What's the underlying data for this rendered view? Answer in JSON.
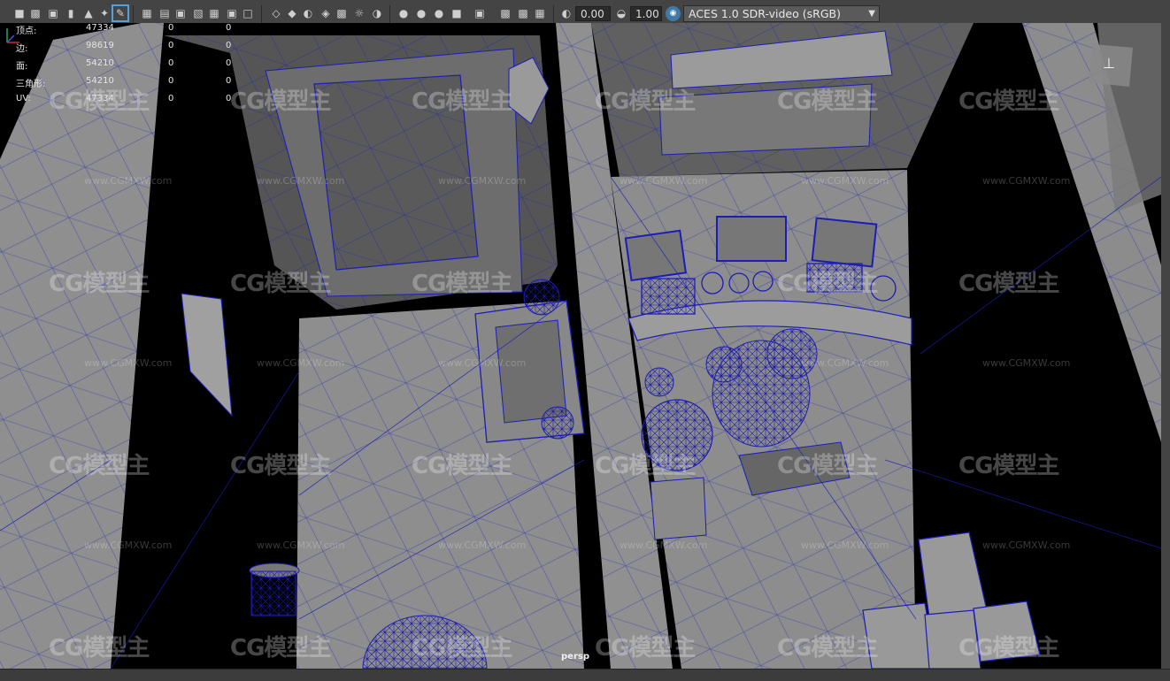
{
  "toolbar": {
    "icons": [
      "camera-icon",
      "camera-attributes-icon",
      "camera-lock-icon",
      "bookmark-icon",
      "image-plane-icon",
      "2d-pan-icon",
      "grease-pencil-icon",
      "grid-icon",
      "film-gate-icon",
      "resolution-gate-icon",
      "gate-mask-icon",
      "field-chart-icon",
      "safe-action-icon",
      "safe-title-icon",
      "wireframe-icon",
      "smooth-shade-icon",
      "default-material-icon",
      "wireframe-on-shaded-icon",
      "textured-icon",
      "use-all-lights-icon",
      "shadows-icon",
      "screen-space-ao-icon",
      "motion-blur-icon",
      "anti-aliasing-icon",
      "isolate-select-icon",
      "xray-icon",
      "xray-joints-icon",
      "xray-components-icon",
      "exposure-icon",
      "gamma-icon"
    ],
    "exposure_value": "0.00",
    "gamma_value": "1.00",
    "color_space": "ACES 1.0 SDR-video (sRGB)"
  },
  "hud": {
    "rows": [
      {
        "label": "顶点:",
        "v1": "47334",
        "v2": "0",
        "v3": "0"
      },
      {
        "label": "边:",
        "v1": "98619",
        "v2": "0",
        "v3": "0"
      },
      {
        "label": "面:",
        "v1": "54210",
        "v2": "0",
        "v3": "0"
      },
      {
        "label": "三角形:",
        "v1": "54210",
        "v2": "0",
        "v3": "0"
      },
      {
        "label": "UV:",
        "v1": "47334",
        "v2": "0",
        "v3": "0"
      }
    ]
  },
  "viewport": {
    "camera_label": "persp",
    "wireframe_color": "#1c1cb8",
    "shaded_color": "#8e8e8e"
  },
  "watermark": {
    "brand": "CG模型主",
    "url": "www.CGMXW.com"
  }
}
